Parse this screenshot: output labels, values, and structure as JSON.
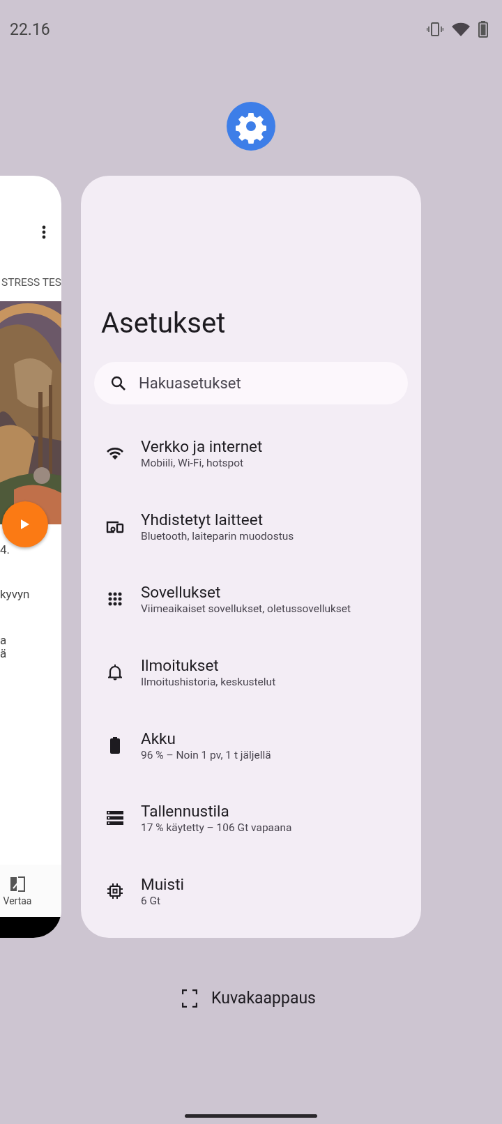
{
  "status_bar": {
    "time": "22.16"
  },
  "left_card": {
    "tab_label": "STRESS TES",
    "text_lines": [
      "4.",
      "kyvyn",
      "a",
      "ä"
    ],
    "bottom_nav": {
      "label": "Vertaa"
    }
  },
  "settings_card": {
    "title": "Asetukset",
    "search": {
      "placeholder": "Hakuasetukset"
    },
    "items": [
      {
        "title": "Verkko ja internet",
        "subtitle": "Mobiili, Wi-Fi, hotspot"
      },
      {
        "title": "Yhdistetyt laitteet",
        "subtitle": "Bluetooth, laiteparin muodostus"
      },
      {
        "title": "Sovellukset",
        "subtitle": "Viimeaikaiset sovellukset, oletussovellukset"
      },
      {
        "title": "Ilmoitukset",
        "subtitle": "Ilmoitushistoria, keskustelut"
      },
      {
        "title": "Akku",
        "subtitle": "96 % – Noin 1 pv, 1 t jäljellä"
      },
      {
        "title": "Tallennustila",
        "subtitle": "17 % käytetty – 106 Gt vapaana"
      },
      {
        "title": "Muisti",
        "subtitle": "6 Gt"
      }
    ]
  },
  "screenshot_button": {
    "label": "Kuvakaappaus"
  }
}
